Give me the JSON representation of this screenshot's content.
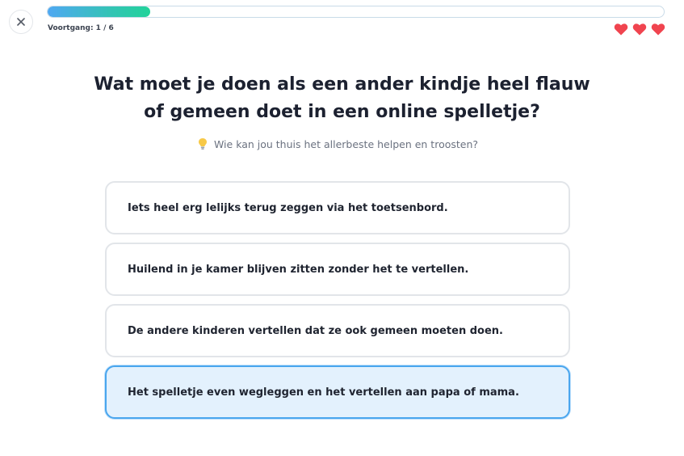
{
  "header": {
    "close_icon": "close-icon",
    "progress": {
      "current": 1,
      "total": 6,
      "fraction": 0.167,
      "label": "Voortgang: 1 / 6"
    },
    "lives": {
      "count": 3,
      "icon": "heart-icon",
      "color": "#f0444f"
    }
  },
  "question": {
    "text": "Wat moet je doen als een ander kindje heel flauw of gemeen doet in een online spelletje?",
    "hint_icon": "lightbulb-icon",
    "hint": "Wie kan jou thuis het allerbeste helpen en troosten?"
  },
  "options": [
    {
      "label": "Iets heel erg lelijks terug zeggen via het toetsenbord.",
      "selected": false
    },
    {
      "label": "Huilend in je kamer blijven zitten zonder het te vertellen.",
      "selected": false
    },
    {
      "label": "De andere kinderen vertellen dat ze ook gemeen moeten doen.",
      "selected": false
    },
    {
      "label": "Het spelletje even wegleggen en het vertellen aan papa of mama.",
      "selected": true
    }
  ],
  "colors": {
    "accent": "#4aa6ee",
    "selected_bg": "#e3f1fd",
    "progress_start": "#4fa8f2",
    "progress_end": "#22d39a"
  }
}
